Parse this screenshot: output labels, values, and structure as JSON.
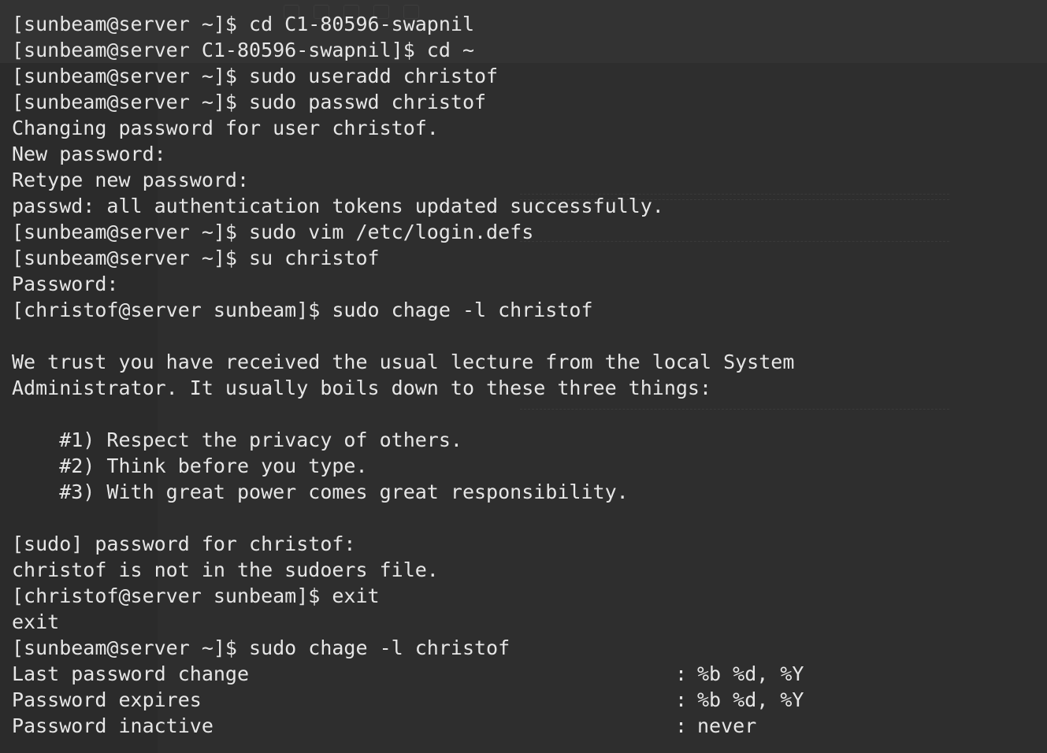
{
  "terminal": {
    "lines": [
      "[sunbeam@server ~]$ cd C1-80596-swapnil",
      "[sunbeam@server C1-80596-swapnil]$ cd ~",
      "[sunbeam@server ~]$ sudo useradd christof",
      "[sunbeam@server ~]$ sudo passwd christof",
      "Changing password for user christof.",
      "New password:",
      "Retype new password:",
      "passwd: all authentication tokens updated successfully.",
      "[sunbeam@server ~]$ sudo vim /etc/login.defs",
      "[sunbeam@server ~]$ su christof",
      "Password:",
      "[christof@server sunbeam]$ sudo chage -l christof",
      "",
      "We trust you have received the usual lecture from the local System",
      "Administrator. It usually boils down to these three things:",
      "",
      "    #1) Respect the privacy of others.",
      "    #2) Think before you type.",
      "    #3) With great power comes great responsibility.",
      "",
      "[sudo] password for christof:",
      "christof is not in the sudoers file.",
      "[christof@server sunbeam]$ exit",
      "exit",
      "[sunbeam@server ~]$ sudo chage -l christof"
    ],
    "chage_output": [
      {
        "key": "Last password change",
        "value": "%b %d, %Y"
      },
      {
        "key": "Password expires",
        "value": "%b %d, %Y"
      },
      {
        "key": "Password inactive",
        "value": "never"
      }
    ],
    "separator": ":"
  }
}
